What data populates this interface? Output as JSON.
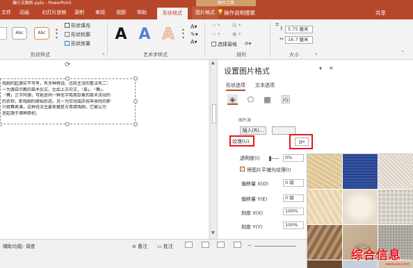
{
  "titlebar": {
    "document": "编小文解析.pptx - PowerPoint",
    "context_group": "图片工具"
  },
  "tabs": [
    {
      "label": "文件"
    },
    {
      "label": "动画"
    },
    {
      "label": "幻灯片放映"
    },
    {
      "label": "录制"
    },
    {
      "label": "审阅"
    },
    {
      "label": "视图"
    },
    {
      "label": "帮助"
    },
    {
      "label": "形状格式"
    },
    {
      "label": "图片格式"
    }
  ],
  "tell_me": "操作说明搜索",
  "share": "共享",
  "ribbon": {
    "style_samples": [
      "Abc",
      "Abc"
    ],
    "shape_fill": "形状填充",
    "shape_outline": "形状轮廓",
    "shape_effects": "形状效果",
    "shape_styles_label": "形状样式",
    "wordart_label": "艺术字样式",
    "wordart_letter": "A",
    "selection_pane": "选择窗格",
    "arrange_label": "排列",
    "size_label": "大小",
    "height_value": "5.75 厘米",
    "width_value": "16.7 厘米"
  },
  "slide": {
    "text_lines": [
      "戏剧的起源实不可考，有多种假说。比较主流的看法有二：",
      "一为源自宗教的巫术仪式，比如上古中文，「巫」、「舞」、",
      "「舞」三字同源，可能是同一种无字商周卦象的巫术活动的",
      "的名称，即戏剧的原始形态。另一为劳动或庆祝丰收时的即",
      "兴歌舞表演，这种说法主要依据是古希腊戏剧，它被认为",
      "是起源于酒神祭祀。"
    ]
  },
  "pane": {
    "title": "设置图片格式",
    "subtabs": [
      "形状选项",
      "文本选项"
    ],
    "section_label": "图片源",
    "insert_button": "插入(R)...",
    "texture_label": "纹理(U)",
    "transparency_label": "透明度(I)",
    "transparency_value": "0%",
    "tile_checkbox_label": "将图片平铺为纹理(I)",
    "tile_checked": "✓",
    "offset_x_label": "偏移量 X(O)",
    "offset_x_value": "0 磅",
    "offset_y_label": "偏移量 Y(E)",
    "offset_y_value": "0 磅",
    "scale_x_label": "刻度 X(X)",
    "scale_x_value": "100%",
    "scale_y_label": "刻度 Y(Y)",
    "scale_y_value": "100%"
  },
  "status": {
    "accessibility": "辅助功能: 调查",
    "notes": "备注",
    "comments": "批注"
  },
  "watermark": {
    "text": "综合信息",
    "url": "www.xxx.com"
  },
  "colors": {
    "accent": "#b7472a",
    "highlight_box": "#e8141a"
  }
}
